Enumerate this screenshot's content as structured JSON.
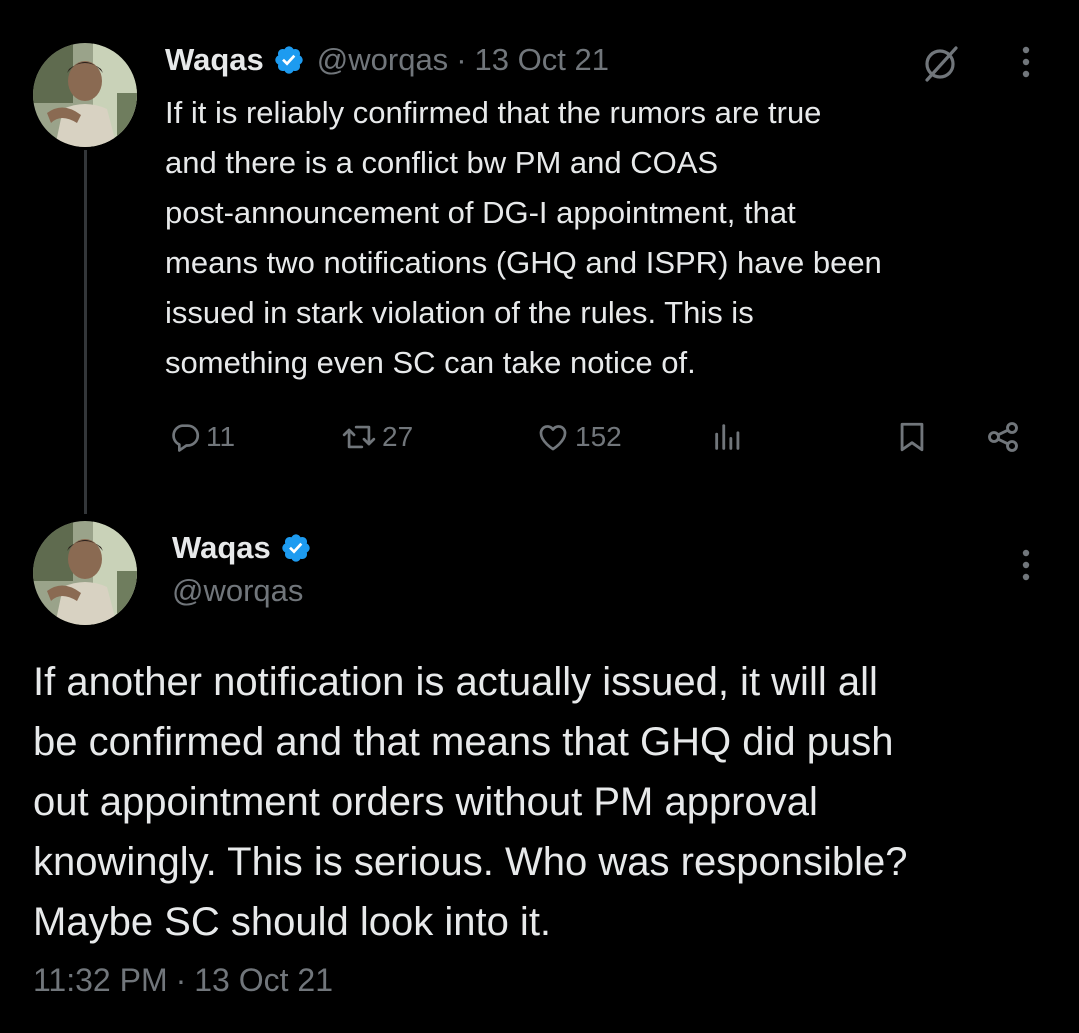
{
  "colors": {
    "background": "#000000",
    "text_primary": "#e7e9ea",
    "text_secondary": "#71767b",
    "verified_badge": "#1d9bf0",
    "thread_line": "#333639"
  },
  "tweet1": {
    "author": {
      "name": "Waqas",
      "handle": "@worqas",
      "verified": true,
      "avatar_icon": "avatar-icon"
    },
    "separator": "·",
    "date": "13 Oct 21",
    "text": "If it is reliably confirmed that the rumors are true\nand there is a conflict bw PM and COAS\npost-announcement of DG-I appointment, that\nmeans two notifications (GHQ and ISPR) have been\nissued in stark violation of the rules. This is\nsomething even SC can take notice of.",
    "actions": {
      "replies": "11",
      "retweets": "27",
      "likes": "152",
      "views": ""
    },
    "icons": [
      "grok-icon",
      "more-icon",
      "reply-icon",
      "retweet-icon",
      "like-icon",
      "views-icon",
      "bookmark-icon",
      "share-icon"
    ]
  },
  "tweet2": {
    "author": {
      "name": "Waqas",
      "handle": "@worqas",
      "verified": true,
      "avatar_icon": "avatar-icon"
    },
    "text": "If another notification is actually issued, it will all\nbe confirmed and that means that GHQ did push\nout appointment orders without PM approval\nknowingly. This is serious. Who was responsible?\nMaybe SC should look into it.",
    "time": "11:32 PM",
    "separator": "·",
    "date": "13 Oct 21",
    "icons": [
      "more-icon"
    ]
  }
}
